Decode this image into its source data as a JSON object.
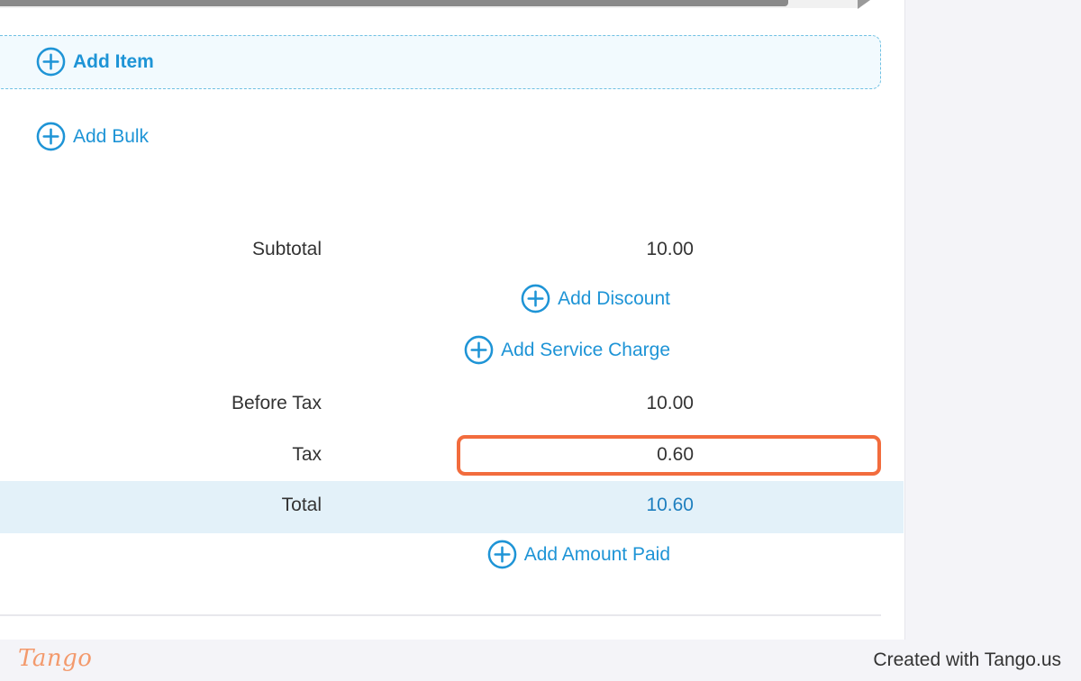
{
  "actions": {
    "add_item": "Add Item",
    "add_bulk": "Add Bulk",
    "add_discount": "Add Discount",
    "add_service_charge": "Add Service Charge",
    "add_amount_paid": "Add Amount Paid"
  },
  "summary": {
    "subtotal_label": "Subtotal",
    "subtotal_value": "10.00",
    "before_tax_label": "Before Tax",
    "before_tax_value": "10.00",
    "tax_label": "Tax",
    "tax_value": "0.60",
    "total_label": "Total",
    "total_value": "10.60"
  },
  "footer": {
    "logo": "Tango",
    "credit": "Created with Tango.us"
  },
  "colors": {
    "accent": "#1e94d6",
    "highlight": "#f26c3d",
    "total_band": "#e3f1f9"
  },
  "icons": {
    "plus": "plus-circle-icon"
  }
}
